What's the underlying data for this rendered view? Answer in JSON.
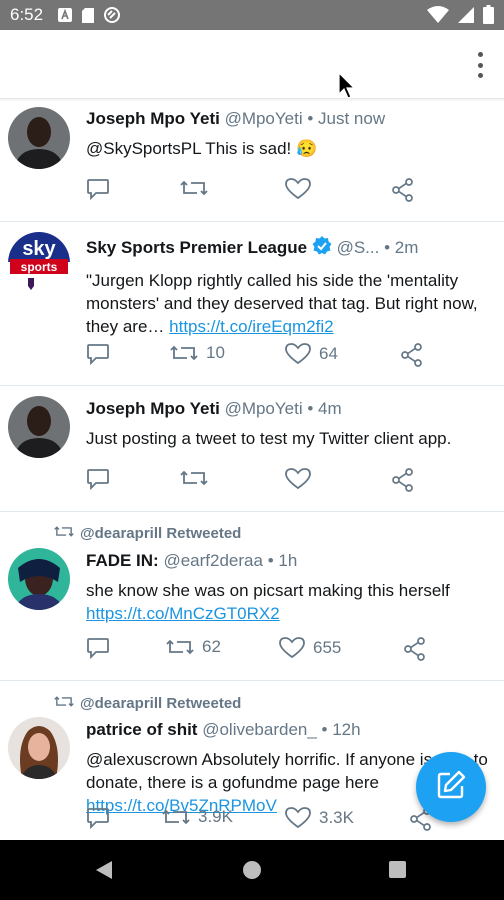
{
  "status_bar": {
    "time": "6:52",
    "left_icons": [
      "app-a-icon",
      "sd-card-icon",
      "sync-icon"
    ],
    "right_icons": [
      "wifi-icon",
      "signal-icon",
      "battery-icon"
    ]
  },
  "app_bar": {
    "menu_icon": "more-vert-icon"
  },
  "tweets": [
    {
      "name": "Joseph Mpo Yeti",
      "handle": "@MpoYeti",
      "time": "• Just now",
      "text": "@SkySportsPL This is sad! 😥",
      "link": "",
      "retweets": "",
      "likes": ""
    },
    {
      "name": "Sky Sports Premier League",
      "verified_icon": "verified-badge-icon",
      "handle": "@S...",
      "time": "• 2m",
      "text": "\"Jurgen Klopp rightly called his side the 'mentality monsters' and they deserved that tag. But right now, they are… ",
      "link": "https://t.co/ireEqm2fi2",
      "retweets": "10",
      "likes": "64",
      "logo_text_1": "sky",
      "logo_text_2": "sports"
    },
    {
      "name": "Joseph Mpo Yeti",
      "handle": "@MpoYeti",
      "time": "• 4m",
      "text": "Just posting a tweet to test my Twitter client app.",
      "link": "",
      "retweets": "",
      "likes": ""
    },
    {
      "retweeted_by": "@dearaprill Retweeted",
      "name": "FADE IN:",
      "handle": "@earf2deraa",
      "time": "• 1h",
      "text": "she know she was on picsart making this herself ",
      "link": "https://t.co/MnCzGT0RX2",
      "retweets": "62",
      "likes": "655"
    },
    {
      "retweeted_by": "@dearaprill Retweeted",
      "name": "patrice of shit",
      "handle": "@olivebarden_",
      "time": "• 12h",
      "text": "@alexuscrown Absolutely horrific. If anyone is able to donate, there is a gofundme page here ",
      "link": "https://t.co/Bv5ZnRPMoV",
      "retweets": "3.9K",
      "likes": "3.3K"
    }
  ],
  "fab": {
    "icon": "compose-icon"
  },
  "nav_bar": {
    "icons": [
      "back-icon",
      "home-icon",
      "recents-icon"
    ]
  },
  "colors": {
    "accent": "#1da1f2",
    "link": "#1b95e0",
    "muted": "#657786",
    "status_bar": "#757575"
  }
}
